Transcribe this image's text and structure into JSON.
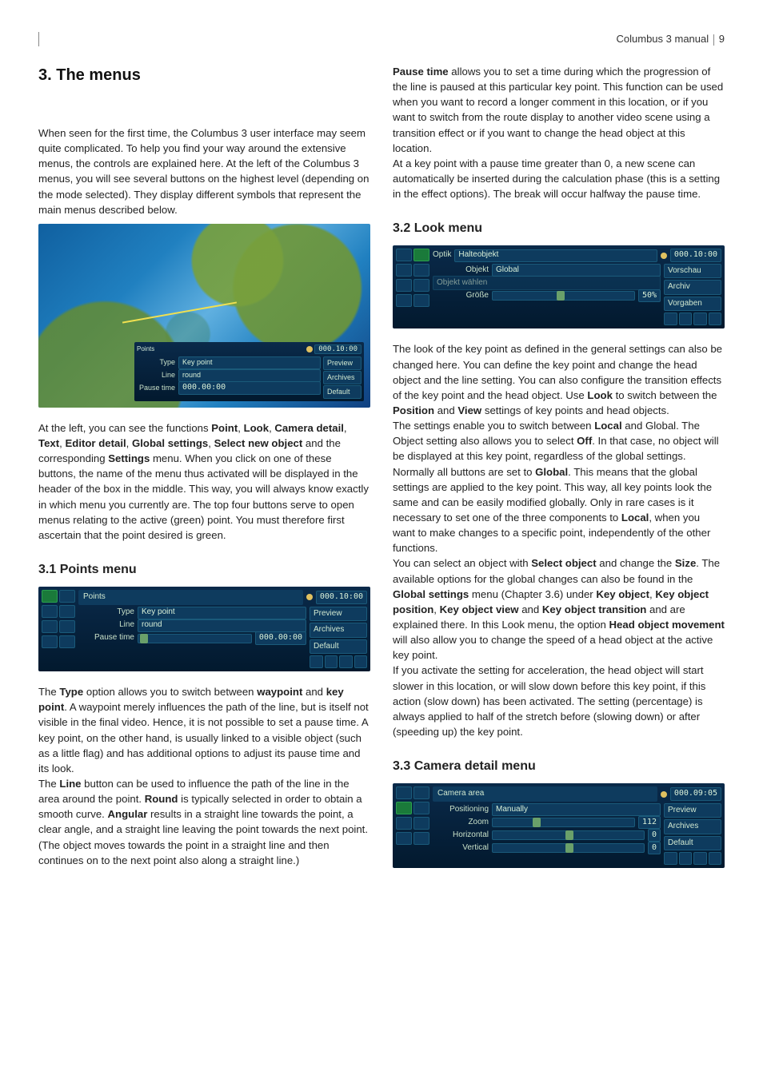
{
  "header": {
    "title": "Columbus 3 manual",
    "page": "9"
  },
  "left": {
    "h1": "3. The menus",
    "p1": "When seen for the first time, the Columbus 3 user interface may seem quite complicated. To help you find your way around the extensive menus, the controls are explained here. At the left of the Columbus 3 menus, you will see several buttons on the highest level (depending on the mode selected). They display different symbols that represent the main menus described below.",
    "map_inset": {
      "title": "Points",
      "time": "000.10:00",
      "rows": {
        "type_lbl": "Type",
        "type_val": "Key point",
        "line_lbl": "Line",
        "line_val": "round",
        "pause_lbl": "Pause time",
        "pause_val": "000.00:00"
      },
      "side": {
        "preview": "Preview",
        "archives": "Archives",
        "default": "Default"
      }
    },
    "p2a": "At the left, you can see the functions ",
    "p2_point": "Point",
    "p2_c1": ", ",
    "p2_look": "Look",
    "p2_c2": ", ",
    "p2_cam": "Camera detail",
    "p2_c3": ", ",
    "p2_text": "Text",
    "p2_c4": ", ",
    "p2_ed": "Editor detail",
    "p2_c5": ", ",
    "p2_gs": "Global settings",
    "p2_c6": ", ",
    "p2_sno": "Select new object",
    "p2_and": " and the corresponding ",
    "p2_set": "Settings",
    "p2b": " menu. When you click on one of these buttons, the name of the menu thus activated will be displayed in the header of the box in the middle. This way, you will always know exactly in which menu you currently are. The top four buttons serve to open menus relating to the active (green) point. You must therefore first ascertain that the point desired is green.",
    "h31": "3.1 Points menu",
    "fig31": {
      "title": "Points",
      "time": "000.10:00",
      "type_lbl": "Type",
      "type_val": "Key point",
      "line_lbl": "Line",
      "line_val": "round",
      "pause_lbl": "Pause time",
      "pause_val": "000.00:00",
      "side": {
        "preview": "Preview",
        "archives": "Archives",
        "default": "Default"
      }
    },
    "p3a": "The ",
    "p3_type": "Type",
    "p3b": " option allows you to switch between ",
    "p3_wp": "waypoint",
    "p3c": " and ",
    "p3_kp": "key point",
    "p3d": ". A waypoint merely influences the path of the line, but is itself not visible in the final video. Hence, it is not possible to set a pause time. A key point, on the other hand, is usually linked to a visible object (such as a little flag) and has additional options to adjust its pause time and its look.",
    "p4a": "The ",
    "p4_line": "Line",
    "p4b": " button can be used to influence the path of the line in the area around the point. ",
    "p4_round": "Round",
    "p4c": " is typically selected in order to obtain a smooth curve. ",
    "p4_ang": "Angular",
    "p4d": " results in a straight line towards the point, a clear angle, and a straight line leaving the point towards the next point. (The object moves towards the point in a straight line and then continues on to the next point also along a straight line.)"
  },
  "right": {
    "p5a": "",
    "p5_pt": "Pause time",
    "p5b": " allows you to set a time during which the progression of the line is paused at this particular key point. This function can be used when you want to record a longer comment in this location, or if you want to switch from the route display to another video scene using a transition effect or if you want to change the head object at this location.",
    "p6": "At a key point with a pause time greater than 0, a new scene can automatically be inserted during the calculation phase (this is a setting in the effect options). The break will occur halfway the pause time.",
    "h32": "3.2 Look menu",
    "fig32": {
      "top_lbl": "Optik",
      "top_val": "Halteobjekt",
      "time": "000.10:00",
      "obj_lbl": "Objekt",
      "obj_val": "Global",
      "select_lbl": "Objekt wählen",
      "size_lbl": "Größe",
      "size_val": "50%",
      "side": {
        "preview": "Vorschau",
        "archives": "Archiv",
        "default": "Vorgaben"
      }
    },
    "p7a": "The look of the key point as defined in the general settings can also be changed here. You can define the key point and change the head object and the line setting. You can also configure the transition effects of the key point and the head object. Use ",
    "p7_look": "Look",
    "p7b": " to switch between the ",
    "p7_pos": "Position",
    "p7c": " and ",
    "p7_view": "View",
    "p7d": " settings of key points and head objects.",
    "p8a": "The settings enable you to switch between ",
    "p8_local": "Local",
    "p8b": " and Global. The Object setting also allows you to select ",
    "p8_off": "Off",
    "p8c": ". In that case, no object will be displayed at this key point, regardless of the global settings. Normally all buttons are set to ",
    "p8_global": "Global",
    "p8d": ". This means that the global settings are applied to the key point. This way, all key points look the same and can be easily modified globally. Only in rare cases is it necessary to set one of the three components to ",
    "p8_local2": "Local",
    "p8e": ", when you want to make changes to a specific point, independently of the other functions.",
    "p9a": "You can select an object with ",
    "p9_so": "Select object",
    "p9b": " and change the ",
    "p9_size": "Size",
    "p9c": ". The available options for the global changes can also be found in the ",
    "p9_gs": "Global settings",
    "p9d": " menu (Chapter 3.6) under ",
    "p9_ko": "Key object",
    "p9e": ", ",
    "p9_kop": "Key object position",
    "p9f": ", ",
    "p9_kov": "Key object view",
    "p9g": " and ",
    "p9_kot": "Key object transition",
    "p9h": " and are explained there. In this Look menu, the option ",
    "p9_hom": "Head object movement",
    "p9i": " will also allow you to change the speed of a head object at the active key point.",
    "p10": "If you activate the setting for acceleration, the head object will start slower in this location, or will slow down before this key point, if this action (slow down) has been activated. The setting (percentage) is always applied to half of the stretch before (slowing down) or after (speeding up) the key point.",
    "h33": "3.3 Camera detail menu",
    "fig33": {
      "title": "Camera area",
      "time": "000.09:05",
      "pos_lbl": "Positioning",
      "pos_val": "Manually",
      "zoom_lbl": "Zoom",
      "zoom_val": "112",
      "hor_lbl": "Horizontal",
      "hor_val": "0",
      "ver_lbl": "Vertical",
      "ver_val": "0",
      "side": {
        "preview": "Preview",
        "archives": "Archives",
        "default": "Default"
      }
    }
  }
}
